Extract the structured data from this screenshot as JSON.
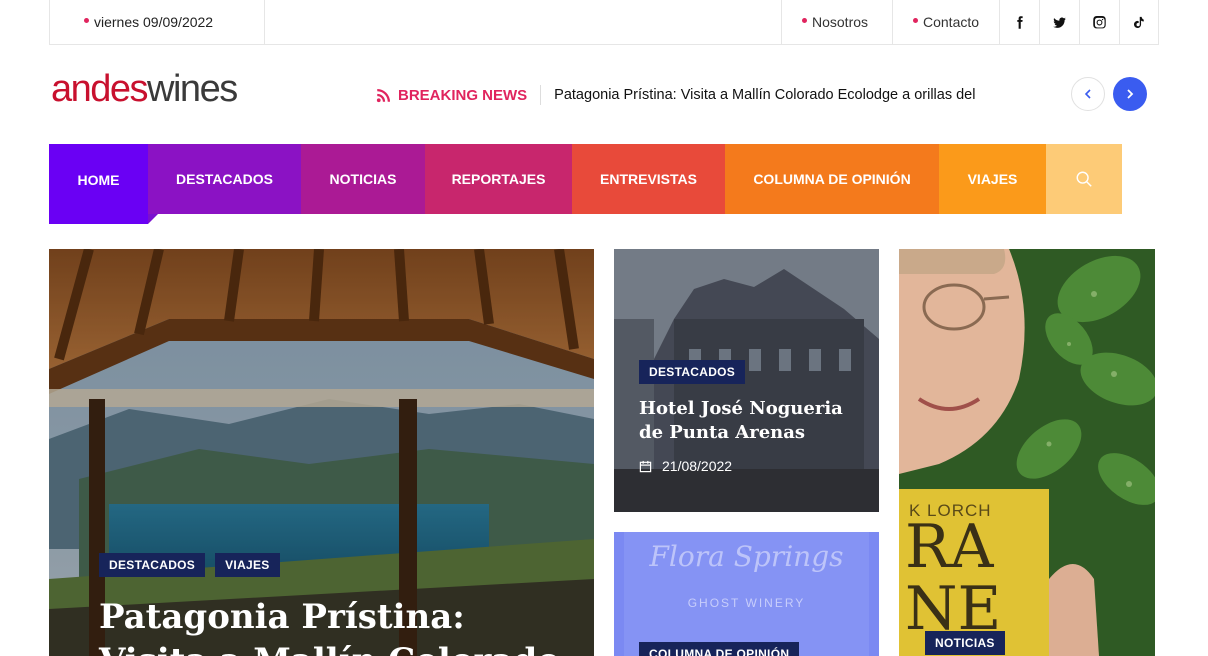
{
  "topbar": {
    "date": "viernes 09/09/2022",
    "links": [
      "Nosotros",
      "Contacto"
    ],
    "social_icons": [
      "facebook-icon",
      "twitter-icon",
      "instagram-icon",
      "tiktok-icon"
    ]
  },
  "header": {
    "logo_part1": "andes",
    "logo_part2": "wines",
    "breaking_label": "BREAKING NEWS",
    "breaking_text": "Patagonia Prístina: Visita a Mallín Colorado Ecolodge a orillas del"
  },
  "menu": {
    "items": [
      {
        "label": "HOME",
        "color": "#6a00f4"
      },
      {
        "label": "DESTACADOS",
        "color": "#8b12c4"
      },
      {
        "label": "NOTICIAS",
        "color": "#ab1a95"
      },
      {
        "label": "REPORTAJES",
        "color": "#c8266d"
      },
      {
        "label": "ENTREVISTAS",
        "color": "#e84a3a"
      },
      {
        "label": "COLUMNA DE OPINIÓN",
        "color": "#f47a1c"
      },
      {
        "label": "VIAJES",
        "color": "#fb9a1a"
      }
    ],
    "search_color": "#fdcb77"
  },
  "cards": {
    "main": {
      "badges": [
        "DESTACADOS",
        "VIAJES"
      ],
      "title": "Patagonia Prístina: Visita a Mallín Colorado"
    },
    "hotel": {
      "badge": "DESTACADOS",
      "title": "Hotel José Nogueria de Punta Arenas",
      "date": "21/08/2022"
    },
    "winery": {
      "badge": "COLUMNA DE OPINIÓN",
      "sign_line1": "Flora Springs",
      "sign_line2": "GHOST WINERY"
    },
    "person": {
      "badge": "NOTICIAS",
      "book_line1": "K LORCH",
      "book_line2": "RA",
      "book_line3": "NE"
    }
  }
}
